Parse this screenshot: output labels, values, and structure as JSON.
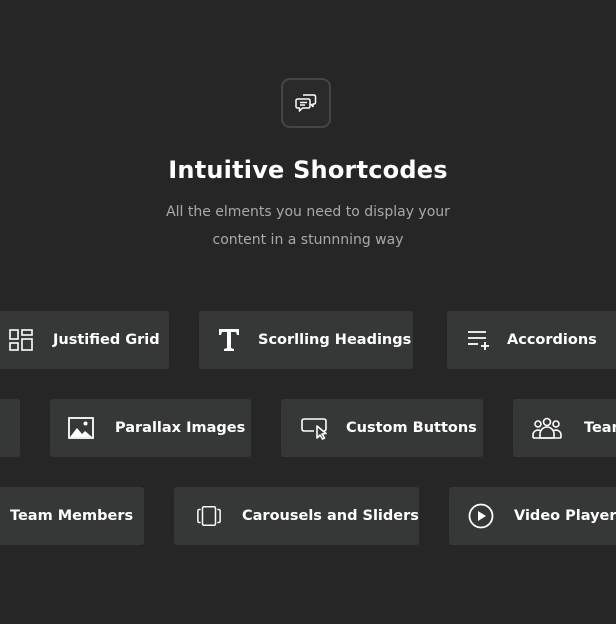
{
  "header": {
    "icon": "chat-bubbles-icon",
    "title": "Intuitive Shortcodes",
    "subtitle_line1": "All the elments you need to display your",
    "subtitle_line2": "content in a stunnning way"
  },
  "rows": [
    [
      {
        "label": "Justified Grid",
        "icon": "grid-layout-icon"
      },
      {
        "label": "Scorlling Headings",
        "icon": "text-t-icon"
      },
      {
        "label": "Accordions",
        "icon": "list-add-icon"
      }
    ],
    [
      {
        "label": "",
        "icon": ""
      },
      {
        "label": "Parallax Images",
        "icon": "image-icon"
      },
      {
        "label": "Custom Buttons",
        "icon": "button-cursor-icon"
      },
      {
        "label": "Team",
        "icon": "group-icon"
      }
    ],
    [
      {
        "label": "Team Members",
        "icon": ""
      },
      {
        "label": "Carousels and Sliders",
        "icon": "carousel-icon"
      },
      {
        "label": "Video Player",
        "icon": "play-circle-icon"
      }
    ]
  ],
  "colors": {
    "background": "#262626",
    "card": "#363737",
    "text": "#ffffff",
    "subtext": "#a9a9a9"
  }
}
